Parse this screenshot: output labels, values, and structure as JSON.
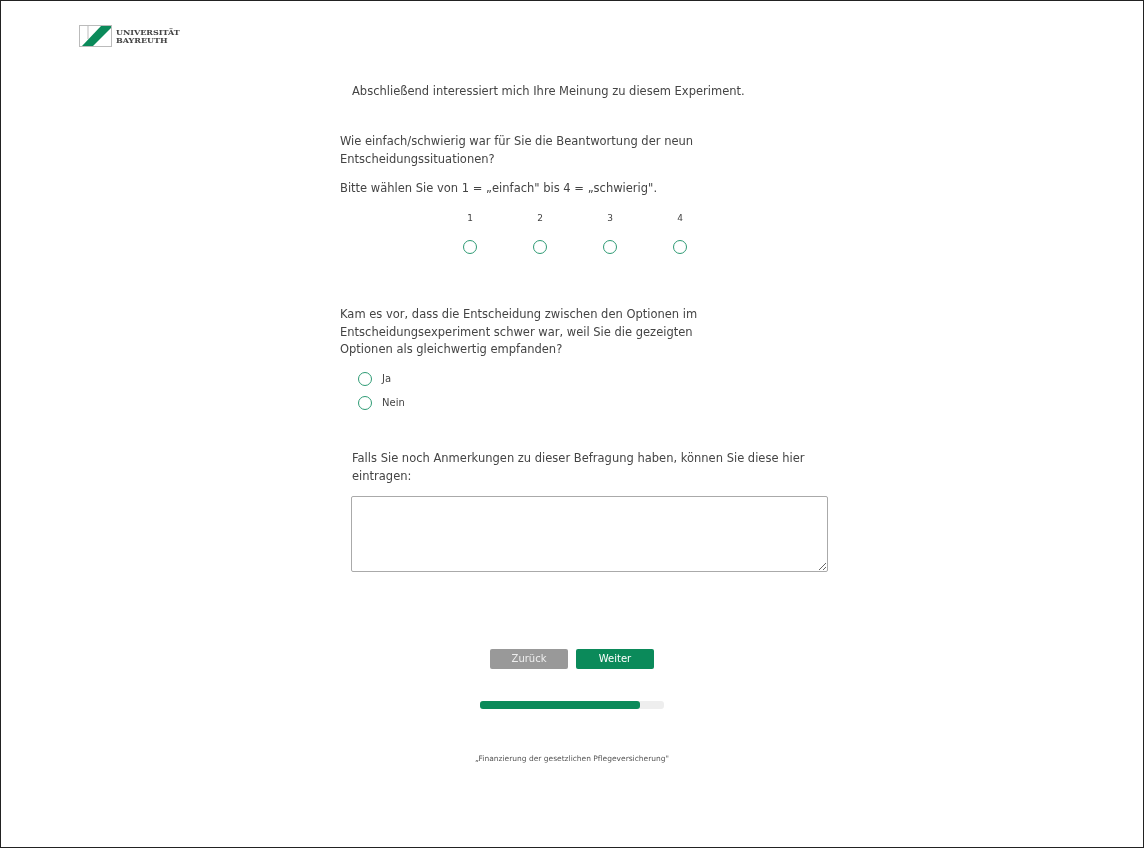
{
  "logo": {
    "line1": "UNIVERSITÄT",
    "line2": "BAYREUTH"
  },
  "intro": "Abschließend interessiert mich Ihre Meinung zu diesem Experiment.",
  "question1": {
    "text": "Wie einfach/schwierig war für Sie die Beantwortung der neun Entscheidungssituationen?",
    "hint": "Bitte wählen Sie von 1 = „einfach\" bis 4 = „schwierig\".",
    "scale": [
      {
        "label": "1",
        "selected": false
      },
      {
        "label": "2",
        "selected": false
      },
      {
        "label": "3",
        "selected": false
      },
      {
        "label": "4",
        "selected": false
      }
    ]
  },
  "question2": {
    "text": "Kam es vor, dass die Entscheidung zwischen den Optionen im Entscheidungsexperiment schwer war, weil Sie die gezeigten Optionen als gleichwertig empfanden?",
    "options": [
      {
        "label": "Ja",
        "selected": false
      },
      {
        "label": "Nein",
        "selected": false
      }
    ]
  },
  "question3": {
    "text": "Falls Sie noch Anmerkungen zu dieser Befragung haben, können Sie diese hier eintragen:"
  },
  "buttons": [
    {
      "label": "Zurück",
      "kind": "back"
    },
    {
      "label": "Weiter",
      "kind": "next"
    }
  ],
  "progress": {
    "level": 0.87
  },
  "footer": "„Finanzierung der gesetzlichen Pflegeversicherung\""
}
